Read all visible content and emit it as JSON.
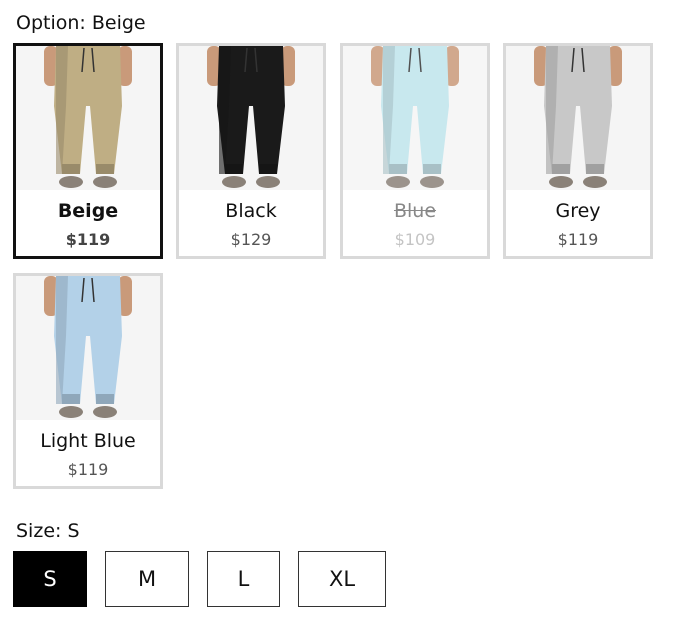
{
  "option": {
    "label": "Option:",
    "value": "Beige"
  },
  "variants": [
    {
      "name": "Beige",
      "price": "$119",
      "selected": true,
      "available": true,
      "color": "#bfae84"
    },
    {
      "name": "Black",
      "price": "$129",
      "selected": false,
      "available": true,
      "color": "#1a1a1a"
    },
    {
      "name": "Blue",
      "price": "$109",
      "selected": false,
      "available": false,
      "color": "#bfe4ec"
    },
    {
      "name": "Grey",
      "price": "$119",
      "selected": false,
      "available": true,
      "color": "#c8c8c8"
    },
    {
      "name": "Light Blue",
      "price": "$119",
      "selected": false,
      "available": true,
      "color": "#b3d1e8"
    }
  ],
  "size": {
    "label": "Size:",
    "value": "S",
    "options": [
      "S",
      "M",
      "L",
      "XL"
    ]
  }
}
